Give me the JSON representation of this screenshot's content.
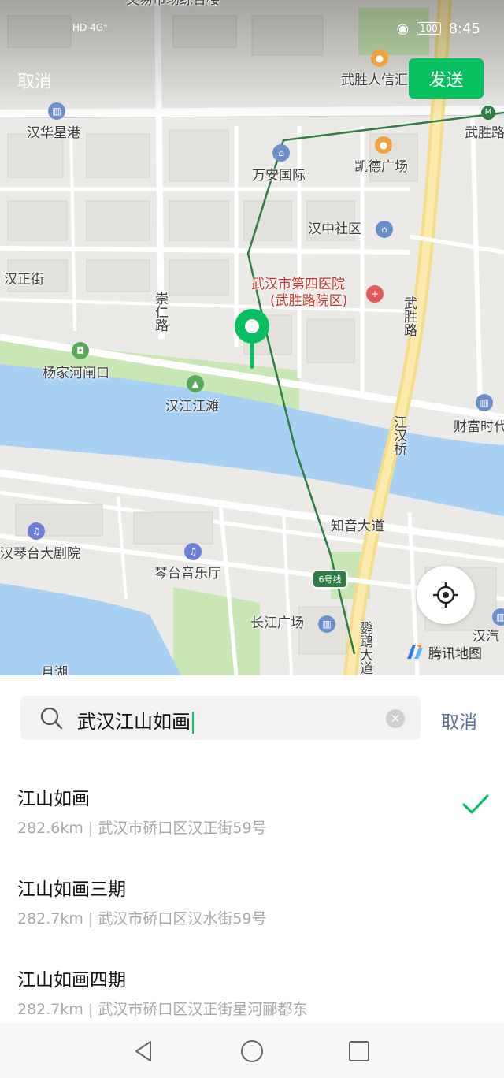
{
  "status_bar": {
    "left": "HD 4G⁺",
    "time": "8:45",
    "battery": "100"
  },
  "top_bar": {
    "cancel_label": "取消",
    "send_label": "发送"
  },
  "map": {
    "labels": {
      "top_cut": "文易市场综合楼",
      "wusheng_renxin": "武胜人信汇",
      "wushenglu_station": "武胜路",
      "hanhua_xinggang": "汉华星港",
      "wanan_guoji": "万安国际",
      "kaide_guangchang": "凯德广场",
      "hanzhong_shequ": "汉中社区",
      "hanzheng_jie": "汉正街",
      "hospital_1": "武汉市第四医院",
      "hospital_2": "(武胜路院区)",
      "chongren_lu": "崇仁路",
      "wusheng_lu": "武胜路",
      "yangjiahe_zhakou": "杨家河闸口",
      "hanjiang_jiangtan": "汉江江滩",
      "jianghan_qiao": "江汉桥",
      "caifu_shidai": "财富时代",
      "zhiyin_dadao": "知音大道",
      "qintai_dajuyuan": "汉琴台大剧院",
      "qintai_yinyueting": "琴台音乐厅",
      "changjiang_guangchang": "长江广场",
      "yinghe_dadao": "鹦鹉大道",
      "hanqi": "汉汽",
      "yuehu": "月湖"
    },
    "line_badge": "6号线",
    "provider": "腾讯地图"
  },
  "search": {
    "value": "武汉江山如画",
    "cancel_label": "取消"
  },
  "results": [
    {
      "name": "江山如画",
      "address": "282.6km | 武汉市硚口区汉正街59号",
      "selected": true
    },
    {
      "name": "江山如画三期",
      "address": "282.7km | 武汉市硚口区汉水街59号",
      "selected": false
    },
    {
      "name": "江山如画四期",
      "address": "282.7km | 武汉市硚口区汉正街星河郦都东",
      "selected": false
    }
  ],
  "colors": {
    "accent": "#07c160",
    "link": "#576b95",
    "water": "#a8d0f3",
    "park": "#c9e7b5",
    "metro": "#2e7d45"
  }
}
